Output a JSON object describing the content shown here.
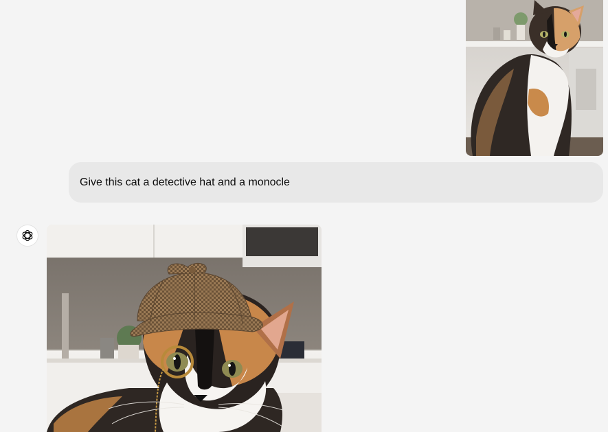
{
  "conversation": {
    "user_message": {
      "image": {
        "alt": "calico cat",
        "kind": "photo"
      },
      "text": "Give this cat a detective hat and a monocle"
    },
    "assistant_message": {
      "avatar_icon": "openai-logo-icon",
      "image": {
        "alt": "calico cat wearing a detective hat and monocle",
        "kind": "generated-image"
      }
    }
  },
  "colors": {
    "page_background": "#f4f4f4",
    "user_bubble": "#e8e8e8",
    "text": "#0d0d0d"
  }
}
